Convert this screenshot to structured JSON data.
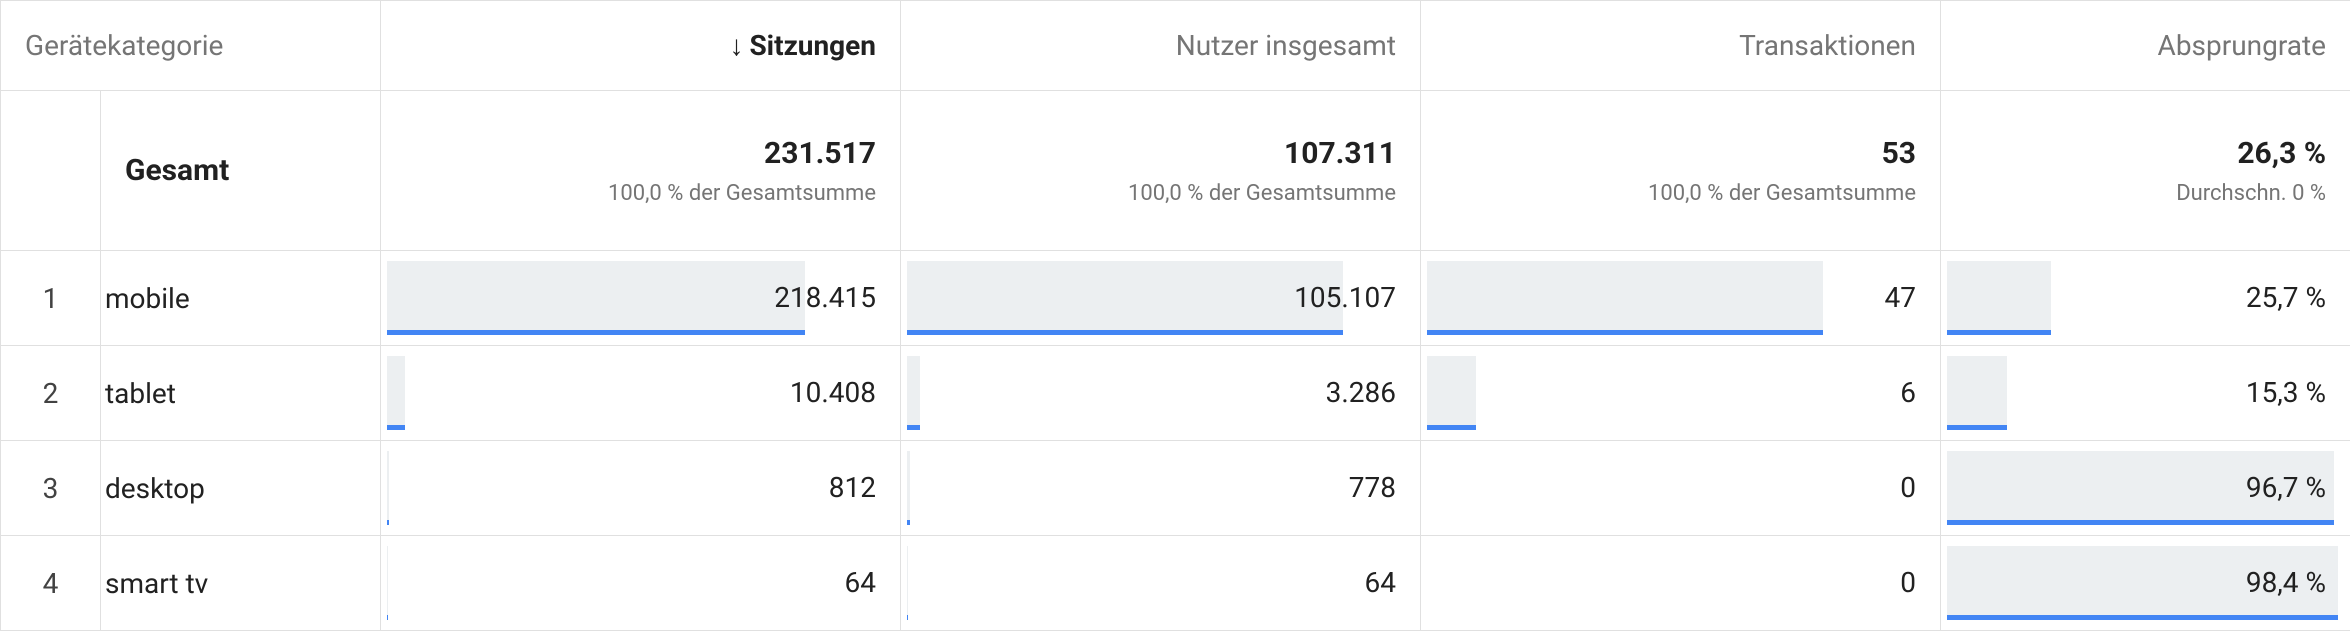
{
  "columns": {
    "category_header": "Gerätekategorie",
    "metrics": [
      "Sitzungen",
      "Nutzer insgesamt",
      "Transaktionen",
      "Absprungrate"
    ],
    "sorted_index": 0,
    "sort_dir": "desc"
  },
  "totals": {
    "label": "Gesamt",
    "values": [
      "231.517",
      "107.311",
      "53",
      "26,3 %"
    ],
    "sub": [
      "100,0 % der Gesamtsumme",
      "100,0 % der Gesamtsumme",
      "100,0 % der Gesamtsumme",
      "Durchschn. 0 %"
    ]
  },
  "rows": [
    {
      "idx": "1",
      "category": "mobile",
      "values": [
        "218.415",
        "105.107",
        "47",
        "25,7 %"
      ],
      "bars": [
        94,
        98,
        89,
        26
      ]
    },
    {
      "idx": "2",
      "category": "tablet",
      "values": [
        "10.408",
        "3.286",
        "6",
        "15,3 %"
      ],
      "bars": [
        4,
        3,
        11,
        15
      ]
    },
    {
      "idx": "3",
      "category": "desktop",
      "values": [
        "812",
        "778",
        "0",
        "96,7 %"
      ],
      "bars": [
        0.4,
        0.7,
        0,
        97
      ]
    },
    {
      "idx": "4",
      "category": "smart tv",
      "values": [
        "64",
        "64",
        "0",
        "98,4 %"
      ],
      "bars": [
        0.03,
        0.06,
        0,
        98
      ]
    }
  ],
  "colors": {
    "bar_fill": "#eceff1",
    "bar_underline": "#4285f4"
  },
  "chart_data": {
    "type": "table",
    "title": "",
    "columns": [
      "Gerätekategorie",
      "Sitzungen",
      "Nutzer insgesamt",
      "Transaktionen",
      "Absprungrate"
    ],
    "totals": {
      "Sitzungen": 231517,
      "Nutzer insgesamt": 107311,
      "Transaktionen": 53,
      "Absprungrate_pct": 26.3
    },
    "rows": [
      {
        "Gerätekategorie": "mobile",
        "Sitzungen": 218415,
        "Nutzer insgesamt": 105107,
        "Transaktionen": 47,
        "Absprungrate_pct": 25.7
      },
      {
        "Gerätekategorie": "tablet",
        "Sitzungen": 10408,
        "Nutzer insgesamt": 3286,
        "Transaktionen": 6,
        "Absprungrate_pct": 15.3
      },
      {
        "Gerätekategorie": "desktop",
        "Sitzungen": 812,
        "Nutzer insgesamt": 778,
        "Transaktionen": 0,
        "Absprungrate_pct": 96.7
      },
      {
        "Gerätekategorie": "smart tv",
        "Sitzungen": 64,
        "Nutzer insgesamt": 64,
        "Transaktionen": 0,
        "Absprungrate_pct": 98.4
      }
    ]
  }
}
